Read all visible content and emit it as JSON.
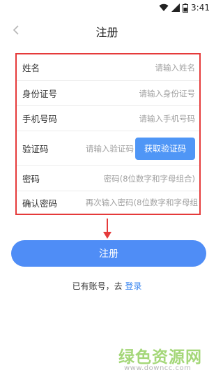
{
  "status_bar": {
    "time": "3:41",
    "icons": [
      "wifi-icon",
      "signal-icon",
      "battery-icon"
    ]
  },
  "header": {
    "back_icon": "chevron-left-icon",
    "title": "注册"
  },
  "form": {
    "fields": [
      {
        "label": "姓名",
        "placeholder": "请输入姓名"
      },
      {
        "label": "身份证号",
        "placeholder": "请输入身份证号"
      },
      {
        "label": "手机号码",
        "placeholder": "请输入手机号码"
      },
      {
        "label": "验证码",
        "placeholder": "请输入验证码",
        "action_label": "获取验证码"
      },
      {
        "label": "密码",
        "placeholder": "密码(8位数字和字母组合)"
      },
      {
        "label": "确认密码",
        "placeholder": "再次输入密码(8位数字和字母组"
      }
    ]
  },
  "register_button": {
    "label": "注册"
  },
  "login_prompt": {
    "text": "已有账号，去",
    "link": "登录"
  },
  "watermark": {
    "text": "绿色资源网",
    "url": "www.downcc.com"
  },
  "colors": {
    "accent": "#4f8df6",
    "highlight_border": "#e53a3a",
    "link": "#3a86f0",
    "watermark": "#9bd36a"
  }
}
